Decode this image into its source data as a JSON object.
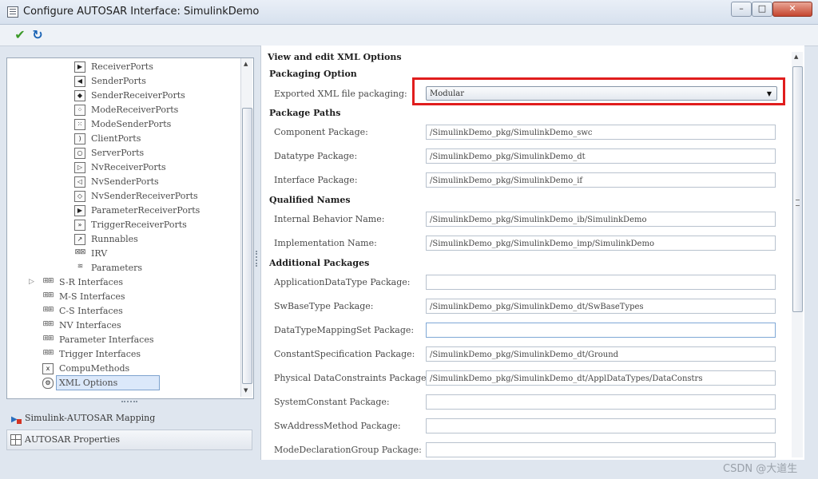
{
  "window": {
    "title": "Configure AUTOSAR Interface: SimulinkDemo",
    "minimize": "–",
    "maximize": "□",
    "close": "✕"
  },
  "toolbar": {
    "apply_icon": "checkmark-icon",
    "revert_icon": "refresh-icon"
  },
  "tree": {
    "items": [
      {
        "label": "ReceiverPorts",
        "icon": "receiver-port-icon"
      },
      {
        "label": "SenderPorts",
        "icon": "sender-port-icon"
      },
      {
        "label": "SenderReceiverPorts",
        "icon": "sender-receiver-port-icon"
      },
      {
        "label": "ModeReceiverPorts",
        "icon": "mode-receiver-port-icon"
      },
      {
        "label": "ModeSenderPorts",
        "icon": "mode-sender-port-icon"
      },
      {
        "label": "ClientPorts",
        "icon": "client-port-icon"
      },
      {
        "label": "ServerPorts",
        "icon": "server-port-icon"
      },
      {
        "label": "NvReceiverPorts",
        "icon": "nv-receiver-port-icon"
      },
      {
        "label": "NvSenderPorts",
        "icon": "nv-sender-port-icon"
      },
      {
        "label": "NvSenderReceiverPorts",
        "icon": "nv-sender-receiver-port-icon"
      },
      {
        "label": "ParameterReceiverPorts",
        "icon": "parameter-receiver-port-icon"
      },
      {
        "label": "TriggerReceiverPorts",
        "icon": "trigger-receiver-port-icon"
      },
      {
        "label": "Runnables",
        "icon": "runnable-icon"
      },
      {
        "label": "IRV",
        "icon": "irv-icon"
      },
      {
        "label": "Parameters",
        "icon": "database-icon"
      },
      {
        "label": "S-R Interfaces",
        "icon": "package-icon"
      },
      {
        "label": "M-S Interfaces",
        "icon": "package-icon"
      },
      {
        "label": "C-S Interfaces",
        "icon": "package-icon"
      },
      {
        "label": "NV Interfaces",
        "icon": "package-icon"
      },
      {
        "label": "Parameter Interfaces",
        "icon": "package-icon"
      },
      {
        "label": "Trigger Interfaces",
        "icon": "package-icon"
      },
      {
        "label": "CompuMethods",
        "icon": "function-icon"
      },
      {
        "label": "XML Options",
        "icon": "gear-icon"
      }
    ],
    "mapping": "Simulink-AUTOSAR Mapping",
    "properties": "AUTOSAR Properties"
  },
  "form": {
    "header": "View and edit XML Options",
    "packaging_heading": "Packaging Option",
    "packaging_label": "Exported XML file packaging:",
    "packaging_value": "Modular",
    "paths_heading": "Package Paths",
    "qualified_heading": "Qualified Names",
    "additional_heading": "Additional Packages",
    "fields": {
      "component": {
        "label": "Component Package:",
        "value": "/SimulinkDemo_pkg/SimulinkDemo_swc"
      },
      "datatype": {
        "label": "Datatype Package:",
        "value": "/SimulinkDemo_pkg/SimulinkDemo_dt"
      },
      "interface": {
        "label": "Interface Package:",
        "value": "/SimulinkDemo_pkg/SimulinkDemo_if"
      },
      "internal_behavior": {
        "label": "Internal Behavior Name:",
        "value": "/SimulinkDemo_pkg/SimulinkDemo_ib/SimulinkDemo"
      },
      "implementation": {
        "label": "Implementation Name:",
        "value": "/SimulinkDemo_pkg/SimulinkDemo_imp/SimulinkDemo"
      },
      "app_datatype": {
        "label": "ApplicationDataType Package:",
        "value": ""
      },
      "swbasetype": {
        "label": "SwBaseType Package:",
        "value": "/SimulinkDemo_pkg/SimulinkDemo_dt/SwBaseTypes"
      },
      "dtmapping": {
        "label": "DataTypeMappingSet Package:",
        "value": ""
      },
      "constant": {
        "label": "ConstantSpecification Package:",
        "value": "/SimulinkDemo_pkg/SimulinkDemo_dt/Ground"
      },
      "phys_constraints": {
        "label": "Physical DataConstraints Package:",
        "value": "/SimulinkDemo_pkg/SimulinkDemo_dt/ApplDataTypes/DataConstrs"
      },
      "sysconst": {
        "label": "SystemConstant Package:",
        "value": ""
      },
      "swaddr": {
        "label": "SwAddressMethod Package:",
        "value": ""
      },
      "modedecl": {
        "label": "ModeDeclarationGroup Package:",
        "value": ""
      }
    }
  },
  "watermark": "CSDN @大道生"
}
